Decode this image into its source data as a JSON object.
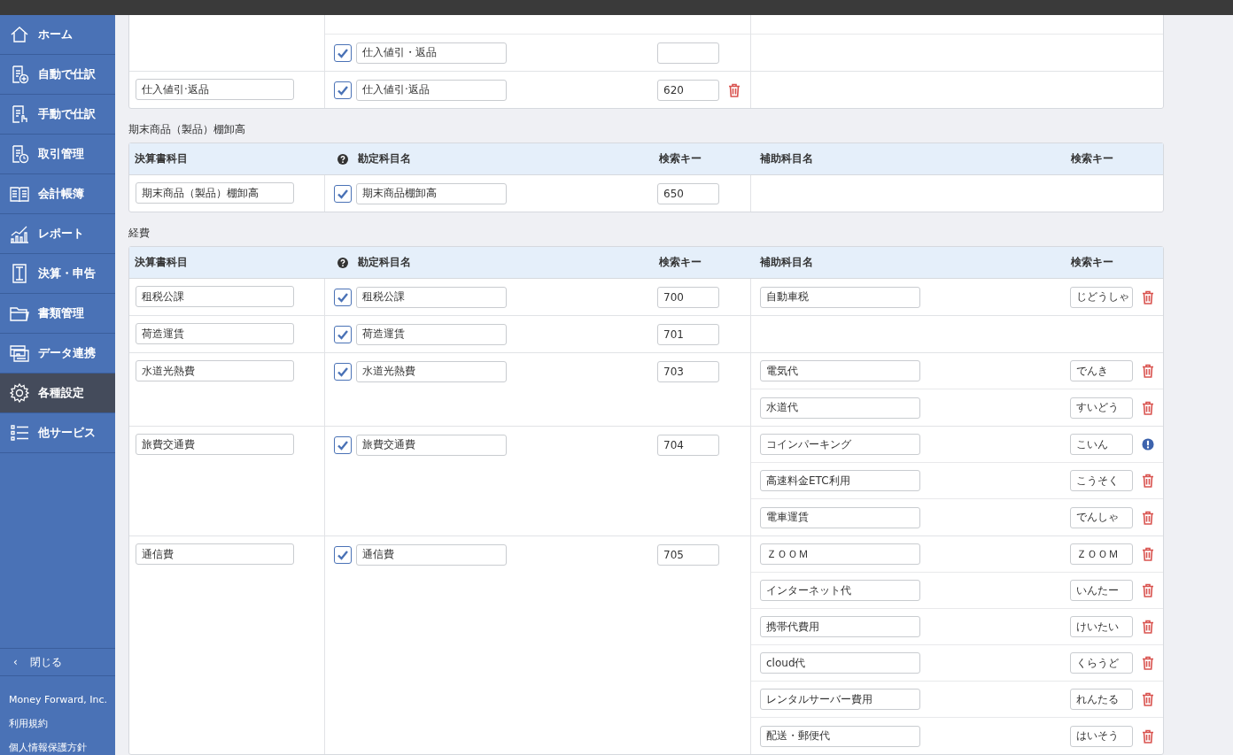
{
  "sidebar": {
    "items": [
      {
        "label": "ホーム",
        "selected": false
      },
      {
        "label": "自動で仕訳",
        "selected": false
      },
      {
        "label": "手動で仕訳",
        "selected": false
      },
      {
        "label": "取引管理",
        "selected": false
      },
      {
        "label": "会計帳簿",
        "selected": false
      },
      {
        "label": "レポート",
        "selected": false
      },
      {
        "label": "決算・申告",
        "selected": false
      },
      {
        "label": "書類管理",
        "selected": false
      },
      {
        "label": "データ連携",
        "selected": false
      },
      {
        "label": "各種設定",
        "selected": true
      },
      {
        "label": "他サービス",
        "selected": false
      }
    ],
    "close": {
      "icon": "‹",
      "label": "閉じる"
    },
    "footer": [
      "Money Forward, Inc.",
      "利用規約",
      "個人情報保護方針"
    ]
  },
  "sections": [
    {
      "groups": [
        {
          "accounts": [
            {
              "checked": true,
              "name": "仕入値引・返品"
            }
          ]
        },
        {
          "statement_item": "仕入値引·返品",
          "accounts": [
            {
              "checked": true,
              "name": "仕入値引·返品",
              "search_key": "620",
              "kind": "delete"
            }
          ]
        }
      ]
    },
    {
      "title": "期末商品（製品）棚卸高",
      "columns": [
        "決算書科目",
        "勘定科目名",
        "検索キー",
        "補助科目名",
        "検索キー"
      ],
      "groups": [
        {
          "statement_item": "期末商品（製品）棚卸高",
          "accounts": [
            {
              "checked": true,
              "name": "期末商品棚卸高",
              "search_key": "650"
            }
          ]
        }
      ]
    },
    {
      "title": "経費",
      "columns": [
        "決算書科目",
        "勘定科目名",
        "検索キー",
        "補助科目名",
        "検索キー"
      ],
      "groups": [
        {
          "statement_item": "租税公課",
          "accounts": [
            {
              "checked": true,
              "name": "租税公課",
              "search_key": "700"
            }
          ],
          "sub_accounts": [
            {
              "name": "自動車税",
              "search_key": "じどうしゃ",
              "kind": "delete"
            }
          ]
        },
        {
          "statement_item": "荷造運賃",
          "accounts": [
            {
              "checked": true,
              "name": "荷造運賃",
              "search_key": "701"
            }
          ]
        },
        {
          "statement_item": "水道光熱費",
          "accounts": [
            {
              "checked": true,
              "name": "水道光熱費",
              "search_key": "703"
            }
          ],
          "sub_accounts": [
            {
              "name": "電気代",
              "search_key": "でんき",
              "kind": "delete"
            },
            {
              "name": "水道代",
              "search_key": "すいどう",
              "kind": "delete"
            }
          ]
        },
        {
          "statement_item": "旅費交通費",
          "accounts": [
            {
              "checked": true,
              "name": "旅費交通費",
              "search_key": "704"
            }
          ],
          "sub_accounts": [
            {
              "name": "コインパーキング",
              "search_key": "こいん",
              "kind": "warning"
            },
            {
              "name": "高速料金ETC利用",
              "search_key": "こうそく",
              "kind": "delete"
            },
            {
              "name": "電車運賃",
              "search_key": "でんしゃ",
              "kind": "delete"
            }
          ]
        },
        {
          "statement_item": "通信費",
          "accounts": [
            {
              "checked": true,
              "name": "通信費",
              "search_key": "705"
            }
          ],
          "sub_accounts": [
            {
              "name": "ＺＯＯＭ",
              "search_key": "ＺＯＯＭ",
              "kind": "delete"
            },
            {
              "name": "インターネット代",
              "search_key": "いんたー",
              "kind": "delete"
            },
            {
              "name": "携帯代費用",
              "search_key": "けいたい",
              "kind": "delete"
            },
            {
              "name": "cloud代",
              "search_key": "くらうど",
              "kind": "delete"
            },
            {
              "name": "レンタルサーバー費用",
              "search_key": "れんたる",
              "kind": "delete"
            },
            {
              "name": "配送・郵便代",
              "search_key": "はいそう",
              "kind": "delete"
            }
          ]
        }
      ]
    }
  ]
}
